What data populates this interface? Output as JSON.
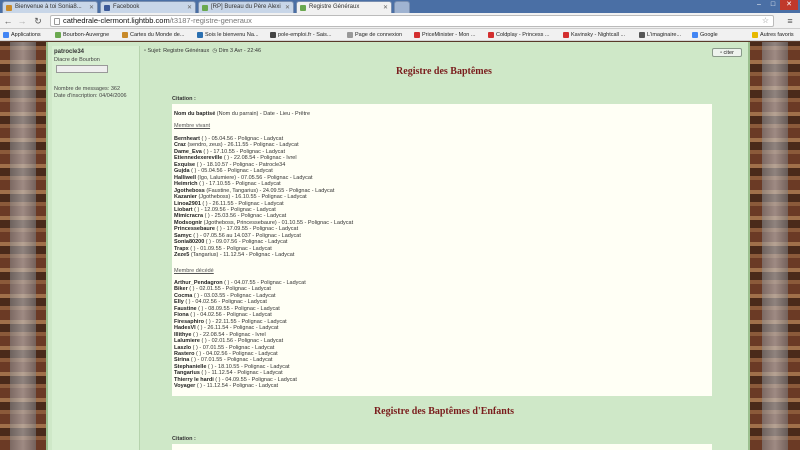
{
  "tabs": [
    {
      "title": "Bienvenue à toi Sonia8...",
      "fav": "#c88a2a",
      "active": false
    },
    {
      "title": "Facebook",
      "fav": "#3b5998",
      "active": false
    },
    {
      "title": "[RP] Bureau du Père Alexi",
      "fav": "#6aa84f",
      "active": false
    },
    {
      "title": "Registre Généraux",
      "fav": "#6aa84f",
      "active": true
    }
  ],
  "address": {
    "host": "cathedrale-clermont.lightbb.com",
    "path": "/t3187-registre-generaux"
  },
  "bookmarks": [
    {
      "label": "Applications",
      "color": "#4285f4"
    },
    {
      "label": "Bourbon-Auvergne",
      "color": "#6aa84f"
    },
    {
      "label": "Cartes du Monde de...",
      "color": "#c88a2a"
    },
    {
      "label": "Sois le bienvenu Na...",
      "color": "#2a6fb0"
    },
    {
      "label": "pole-emploi.fr - Sais...",
      "color": "#444"
    },
    {
      "label": "Page de connexion",
      "color": "#999"
    },
    {
      "label": "PriceMinister - Mon ...",
      "color": "#d32f2f"
    },
    {
      "label": "Coldplay - Princess ...",
      "color": "#d32f2f"
    },
    {
      "label": "Kavinsky - Nightcall ...",
      "color": "#d32f2f"
    },
    {
      "label": "L'imaginaire...",
      "color": "#555"
    },
    {
      "label": "Google",
      "color": "#4285f4"
    },
    {
      "label": "Autres favoris",
      "color": "#e6b800"
    }
  ],
  "profile": {
    "name": "patrocle34",
    "rank": "Diacre de Bourbon",
    "messages": "Nombre de messages: 362",
    "inscription": "Date d'inscription: 04/04/2006"
  },
  "post": {
    "subject": "Sujet: Registre Généraux",
    "date": "Dim 3 Avr - 22:46",
    "citer": "citer"
  },
  "section1": {
    "title": "Registre des Baptêmes",
    "citation": "Citation :",
    "format_bold": "Nom du baptisé",
    "format_rest": " (Nom du parrain) - Date - Lieu - Prêtre",
    "group_living": "Membre vivant",
    "living": [
      {
        "n": "Bernheart",
        "r": " ( ) - 05.04.56 - Polignac - Ladycat"
      },
      {
        "n": "Craz",
        "r": " (sendro, zeus) - 26.11.55 - Polignac - Ladycat"
      },
      {
        "n": "Dame_Eva",
        "r": " ( ) - 17.10.55 - Polignac - Ladycat"
      },
      {
        "n": "Etiennedexereville",
        "r": " ( ) - 22.08.54 - Polignac - Ivrel"
      },
      {
        "n": "Exquise",
        "r": " ( ) - 18.10.57 - Polignac - Patrocle34"
      },
      {
        "n": "Gujda",
        "r": " ( ) - 05.04.56 - Polignac - Ladycat"
      },
      {
        "n": "Halliwell",
        "r": " (Igo, Lalumiere) - 07.05.56 - Polignac - Ladycat"
      },
      {
        "n": "Heimrich",
        "r": " ( ) - 17.10.55 - Polignac - Ladycat"
      },
      {
        "n": "Jgotheboss",
        "r": " (Faustine, Tangarius) - 24.09.55 - Polignac - Ladycat"
      },
      {
        "n": "Kazanier",
        "r": " (Jgotheboss) - 16.10.55 - Polignac - Ladycat"
      },
      {
        "n": "Linoa2901",
        "r": " ( ) - 26.11.55 - Polignac - Ladycat"
      },
      {
        "n": "Liobart",
        "r": " ( ) - 12.09.56 - Polignac - Ladycat"
      },
      {
        "n": "Mimicracra",
        "r": " ( ) - 25.03.56 - Polignac - Ladycat"
      },
      {
        "n": "Modsognir",
        "r": " (Jgotheboss, Princessebaure) - 01.10.55 - Polignac - Ladycat"
      },
      {
        "n": "Princessebaure",
        "r": " ( ) - 17.09.55 - Polignac - Ladycat"
      },
      {
        "n": "Samyc",
        "r": " ( ) - 07.05.56 au 14.037 - Polignac - Ladycat"
      },
      {
        "n": "Sonia80200",
        "r": " ( ) - 09.07.56 - Polignac - Ladycat"
      },
      {
        "n": "Trapx",
        "r": " ( ) - 01.09.55 - Polignac - Ladycat"
      },
      {
        "n": "Zeze5",
        "r": " (Tangarius) - 11.12.54 - Polignac - Ladycat"
      }
    ],
    "group_dead": "Membre décédé",
    "dead": [
      {
        "n": "Arthur_Pendagron",
        "r": " ( ) - 04.07.55 - Polignac - Ladycat"
      },
      {
        "n": "Biker",
        "r": " ( ) - 02.01.55 - Polignac - Ladycat"
      },
      {
        "n": "Cocma",
        "r": " ( ) - 03.03.55 - Polignac - Ladycat"
      },
      {
        "n": "Elly",
        "r": " ( ) - 04.02.56 - Polignac - Ladycat"
      },
      {
        "n": "Faustine",
        "r": " ( ) - 08.09.55 - Polignac - Ladycat"
      },
      {
        "n": "Fiona",
        "r": " ( ) - 04.02.56 - Polignac - Ladycat"
      },
      {
        "n": "Firesaphiro",
        "r": " ( ) - 22.11.55 - Polignac - Ladycat"
      },
      {
        "n": "HadesVI",
        "r": " ( ) - 26.11.54 - Polignac - Ladycat"
      },
      {
        "n": "Illithye",
        "r": " ( ) - 22.08.54 - Polignac - Ivrel"
      },
      {
        "n": "Lalumiere",
        "r": " ( ) - 02.01.56 - Polignac - Ladycat"
      },
      {
        "n": "Laszlo",
        "r": " ( ) - 07.01.55 - Polignac - Ladycat"
      },
      {
        "n": "Rastero",
        "r": " ( ) - 04.02.56 - Polignac - Ladycat"
      },
      {
        "n": "Sirina",
        "r": " ( ) - 07.01.55 - Polignac - Ladycat"
      },
      {
        "n": "Stephanielle",
        "r": " ( ) - 18.10.55 - Polignac - Ladycat"
      },
      {
        "n": "Tangarius",
        "r": " ( ) - 11.12.54 - Polignac - Ladycat"
      },
      {
        "n": "Thierry le hardi",
        "r": " ( ) - 04.09.55 - Polignac - Ladycat"
      },
      {
        "n": "Voyager",
        "r": " ( ) - 11.12.54 - Polignac - Ladycat"
      }
    ]
  },
  "section2": {
    "title": "Registre des Baptêmes d'Enfants",
    "citation": "Citation :"
  }
}
